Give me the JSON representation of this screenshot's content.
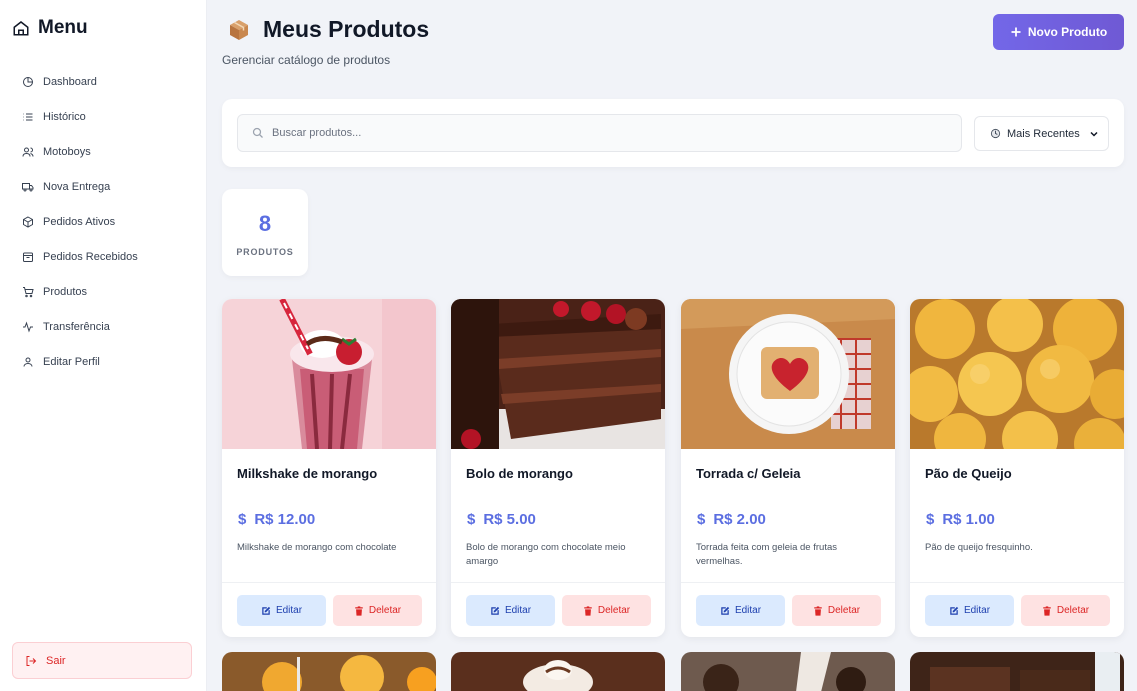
{
  "sidebar": {
    "title": "Menu",
    "items": [
      {
        "label": "Dashboard",
        "icon": "pie-chart-icon"
      },
      {
        "label": "Histórico",
        "icon": "list-icon"
      },
      {
        "label": "Motoboys",
        "icon": "users-icon"
      },
      {
        "label": "Nova Entrega",
        "icon": "truck-icon"
      },
      {
        "label": "Pedidos Ativos",
        "icon": "package-icon"
      },
      {
        "label": "Pedidos Recebidos",
        "icon": "archive-icon"
      },
      {
        "label": "Produtos",
        "icon": "cart-icon"
      },
      {
        "label": "Transferência",
        "icon": "activity-icon"
      },
      {
        "label": "Editar Perfil",
        "icon": "user-icon"
      }
    ],
    "logout_label": "Sair"
  },
  "header": {
    "title": "Meus Produtos",
    "subtitle": "Gerenciar catálogo de produtos",
    "new_button": "Novo Produto"
  },
  "filters": {
    "search_placeholder": "Buscar produtos...",
    "sort_selected": "Mais Recentes"
  },
  "stats": {
    "count": "8",
    "label": "PRODUTOS"
  },
  "products": [
    {
      "name": "Milkshake de morango",
      "price": "R$ 12.00",
      "description": "Milkshake de morango com chocolate",
      "edit": "Editar",
      "delete": "Deletar"
    },
    {
      "name": "Bolo de morango",
      "price": "R$ 5.00",
      "description": "Bolo de morango com chocolate meio amargo",
      "edit": "Editar",
      "delete": "Deletar"
    },
    {
      "name": "Torrada c/ Geleia",
      "price": "R$ 2.00",
      "description": "Torrada feita com geleia de frutas vermelhas.",
      "edit": "Editar",
      "delete": "Deletar"
    },
    {
      "name": "Pão de Queijo",
      "price": "R$ 1.00",
      "description": "Pão de queijo fresquinho.",
      "edit": "Editar",
      "delete": "Deletar"
    }
  ],
  "colors": {
    "accent": "#5b6ee1",
    "button_gradient_start": "#7367e8",
    "danger": "#dc2626"
  }
}
